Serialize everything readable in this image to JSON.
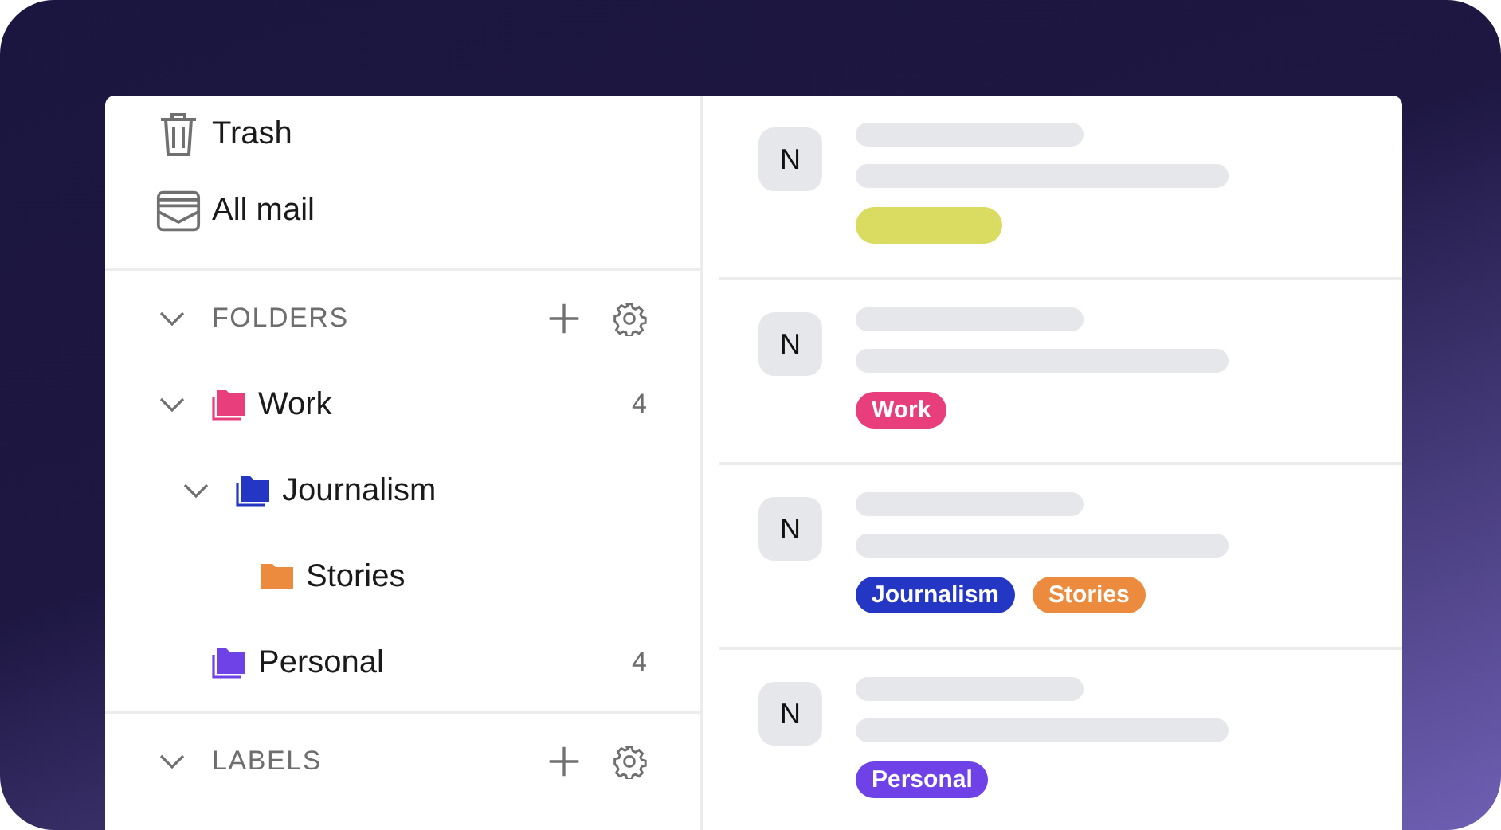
{
  "sidebar": {
    "items": [
      {
        "label": "Trash",
        "kind": "trash"
      },
      {
        "label": "All mail",
        "kind": "allmail"
      }
    ],
    "sections": [
      {
        "title": "FOLDERS",
        "expanded": true,
        "folders": [
          {
            "name": "Work",
            "color": "#e83e7c",
            "count": "4",
            "expanded": true,
            "children": [
              {
                "name": "Journalism",
                "color": "#2436c4",
                "expanded": true,
                "children": [
                  {
                    "name": "Stories",
                    "color": "#ec8a3d"
                  }
                ]
              }
            ]
          },
          {
            "name": "Personal",
            "color": "#6e42e6",
            "count": "4"
          }
        ]
      },
      {
        "title": "LABELS",
        "expanded": true
      }
    ]
  },
  "messages": [
    {
      "avatar": "N",
      "tags": [
        {
          "color": "#dadc62"
        }
      ]
    },
    {
      "avatar": "N",
      "tags": [
        {
          "label": "Work",
          "color": "#e83e7c"
        }
      ]
    },
    {
      "avatar": "N",
      "tags": [
        {
          "label": "Journalism",
          "color": "#2436c4"
        },
        {
          "label": "Stories",
          "color": "#ec8a3d"
        }
      ]
    },
    {
      "avatar": "N",
      "tags": [
        {
          "label": "Personal",
          "color": "#6e42e6"
        }
      ]
    }
  ]
}
